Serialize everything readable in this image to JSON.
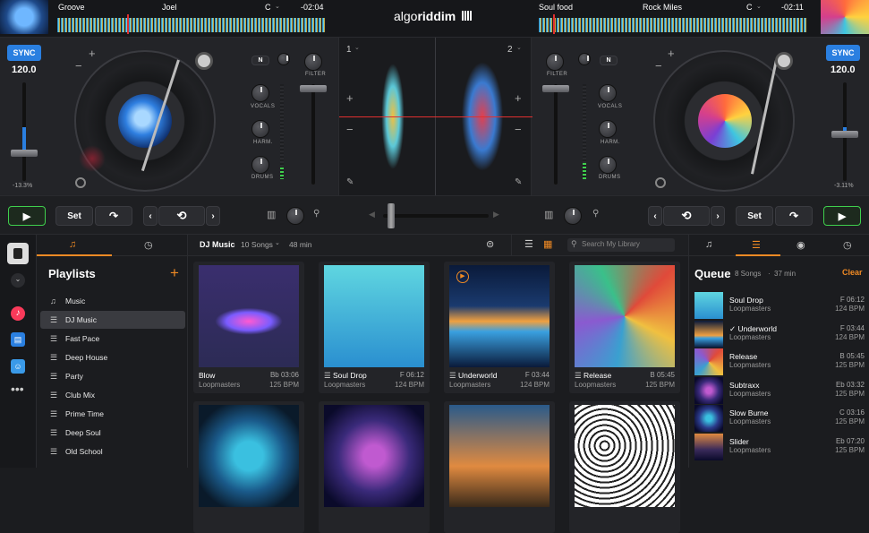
{
  "brand": {
    "name_light": "algo",
    "name_bold": "riddim"
  },
  "deck_left": {
    "title": "Groove",
    "artist": "Joel",
    "key": "C",
    "time": "-02:04",
    "sync": "SYNC",
    "bpm": "120.0",
    "pitch": "-13.3%",
    "filter": "FILTER",
    "eq": [
      "VOCALS",
      "HARM.",
      "DRUMS"
    ],
    "n_label": "N",
    "deck_num": "1"
  },
  "deck_right": {
    "title": "Soul food",
    "artist": "Rock Miles",
    "key": "C",
    "time": "-02:11",
    "sync": "SYNC",
    "bpm": "120.0",
    "pitch": "-3.11%",
    "filter": "FILTER",
    "eq": [
      "VOCALS",
      "HARM.",
      "DRUMS"
    ],
    "n_label": "N",
    "deck_num": "2"
  },
  "transport": {
    "set_left": "Set",
    "set_right": "Set"
  },
  "playlists": {
    "title": "Playlists",
    "items": [
      {
        "label": "Music",
        "icon": "music-note-icon"
      },
      {
        "label": "DJ Music",
        "icon": "playlist-icon"
      },
      {
        "label": "Fast Pace",
        "icon": "playlist-icon"
      },
      {
        "label": "Deep House",
        "icon": "playlist-icon"
      },
      {
        "label": "Party",
        "icon": "playlist-icon"
      },
      {
        "label": "Club Mix",
        "icon": "playlist-icon"
      },
      {
        "label": "Prime Time",
        "icon": "playlist-icon"
      },
      {
        "label": "Deep Soul",
        "icon": "playlist-icon"
      },
      {
        "label": "Old School",
        "icon": "playlist-icon"
      }
    ]
  },
  "library": {
    "name": "DJ Music",
    "count": "10 Songs",
    "duration": "48 min",
    "search_placeholder": "Search My Library",
    "cards": [
      {
        "title": "Blow",
        "artist": "Loopmasters",
        "key": "Bb 03:06",
        "bpm": "125 BPM"
      },
      {
        "title": "Soul Drop",
        "artist": "Loopmasters",
        "key": "F 06:12",
        "bpm": "124 BPM"
      },
      {
        "title": "Underworld",
        "artist": "Loopmasters",
        "key": "F 03:44",
        "bpm": "124 BPM"
      },
      {
        "title": "Release",
        "artist": "Loopmasters",
        "key": "B 05:45",
        "bpm": "125 BPM"
      }
    ]
  },
  "queue": {
    "title": "Queue",
    "count": "8 Songs",
    "duration": "37 min",
    "clear": "Clear",
    "items": [
      {
        "title": "Soul Drop",
        "artist": "Loopmasters",
        "key": "F 06:12",
        "bpm": "124 BPM"
      },
      {
        "title": "Underworld",
        "artist": "Loopmasters",
        "key": "F 03:44",
        "bpm": "124 BPM"
      },
      {
        "title": "Release",
        "artist": "Loopmasters",
        "key": "B 05:45",
        "bpm": "125 BPM"
      },
      {
        "title": "Subtraxx",
        "artist": "Loopmasters",
        "key": "Eb 03:32",
        "bpm": "125 BPM"
      },
      {
        "title": "Slow Burne",
        "artist": "Loopmasters",
        "key": "C 03:16",
        "bpm": "125 BPM"
      },
      {
        "title": "Slider",
        "artist": "Loopmasters",
        "key": "Eb 07:20",
        "bpm": "125 BPM"
      }
    ]
  },
  "colors": {
    "sync": "#2a7fe0",
    "play": "#3fcf4d",
    "accent": "#f08a24",
    "playhead": "#e03030"
  }
}
